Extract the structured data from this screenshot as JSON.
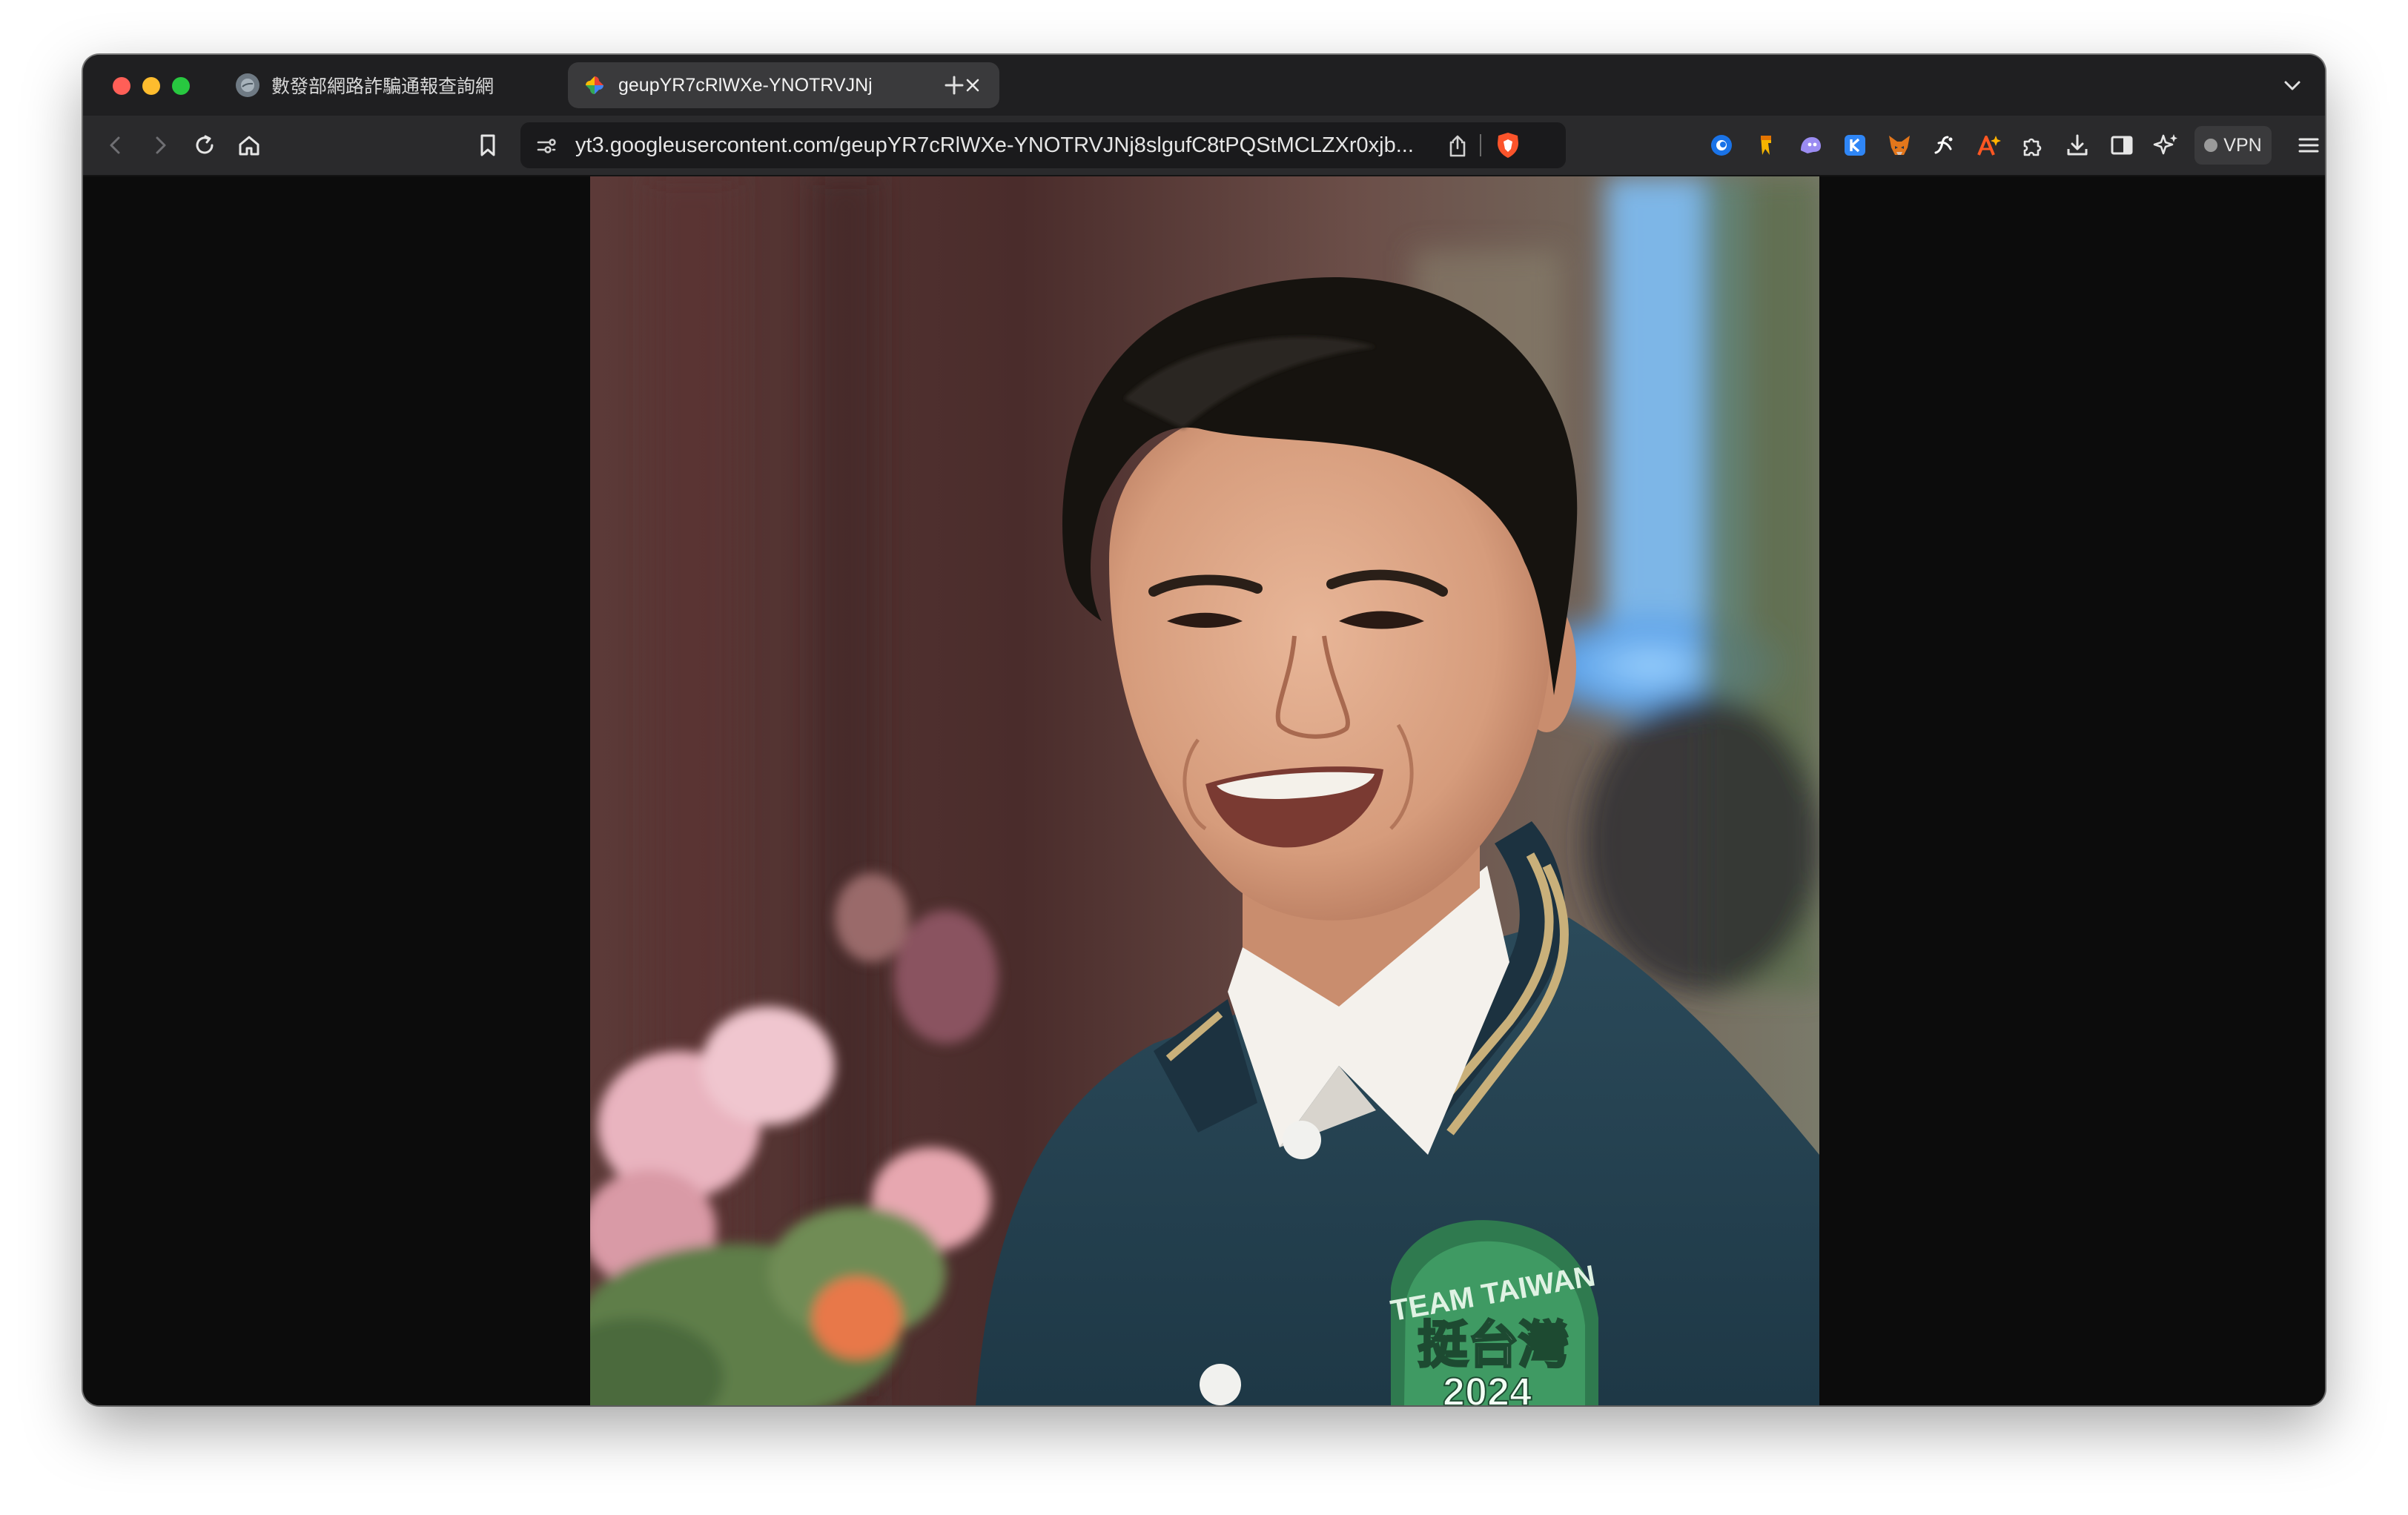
{
  "browser": {
    "tabs": [
      {
        "title": "數發部網路詐騙通報查詢網",
        "active": false,
        "favicon": "globe-icon"
      },
      {
        "title": "geupYR7cRlWXe-YNOTRVJNj",
        "active": true,
        "favicon": "google-photos-pinwheel-icon"
      }
    ],
    "address_bar": {
      "url": "yt3.googleusercontent.com/geupYR7cRlWXe-YNOTRVJNj8slgufC8tPQStMCLZXr0xjb..."
    },
    "vpn_label": "VPN",
    "colors": {
      "close": "#ff5f57",
      "minimize": "#febc2e",
      "maximize": "#28c840",
      "window_bg": "#0c0c0c",
      "toolbar_bg": "#2a2a2c"
    }
  },
  "photo": {
    "subject": "Smiling man with dark hair in a navy varsity jacket, pink flowers and blurred background",
    "patch_text_top": "TEAM TAIWAN",
    "patch_text_middle": "挺台灣",
    "patch_text_bottom": "2024"
  }
}
